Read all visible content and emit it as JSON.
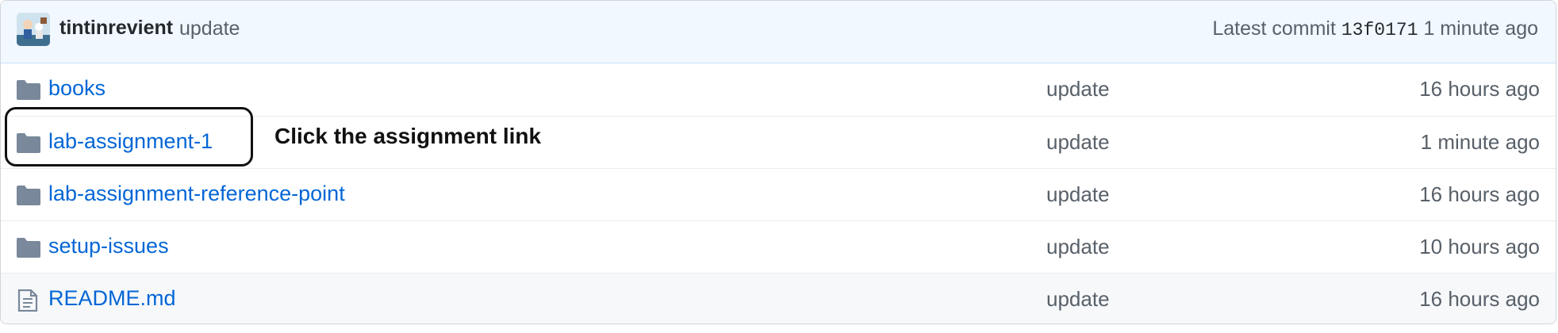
{
  "commit": {
    "author": "tintinrevient",
    "message": "update",
    "latest_label": "Latest commit",
    "sha": "13f0171",
    "age": "1 minute ago"
  },
  "files": [
    {
      "name": "books",
      "icon": "folder-icon",
      "message": "update",
      "age": "16 hours ago"
    },
    {
      "name": "lab-assignment-1",
      "icon": "folder-icon",
      "message": "update",
      "age": "1 minute ago"
    },
    {
      "name": "lab-assignment-reference-point",
      "icon": "folder-icon",
      "message": "update",
      "age": "16 hours ago"
    },
    {
      "name": "setup-issues",
      "icon": "folder-icon",
      "message": "update",
      "age": "10 hours ago"
    },
    {
      "name": "README.md",
      "icon": "file-text-icon",
      "message": "update",
      "age": "16 hours ago"
    }
  ],
  "annotation": {
    "text": "Click the assignment link"
  },
  "colors": {
    "link": "#0366d6",
    "muted": "#586069",
    "header_bg": "#f1f8ff",
    "icon": "#79889a"
  }
}
